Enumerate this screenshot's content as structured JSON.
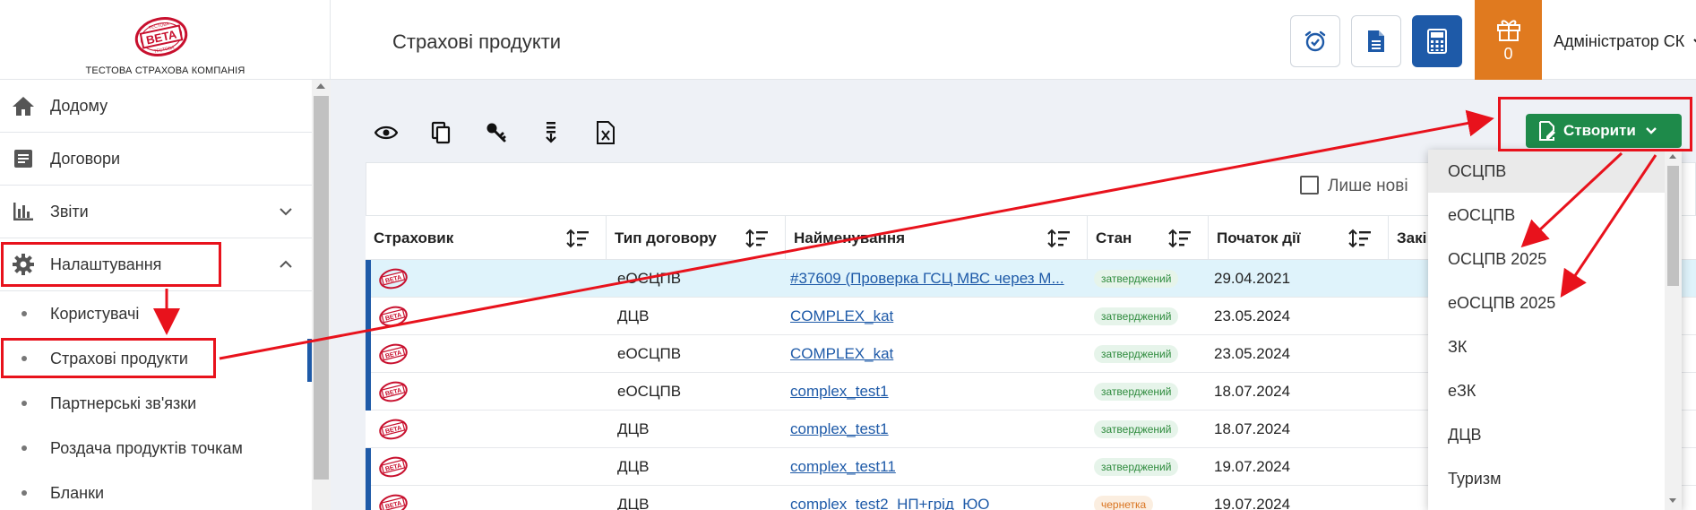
{
  "header": {
    "logo": {
      "seal_text": "BETA",
      "seal_top": "ТЕСТОВА",
      "seal_bottom": "ТЕСТОВА",
      "caption": "ТЕСТОВА СТРАХОВА КОМПАНІЯ"
    },
    "page_title": "Страхові продукти",
    "buttons": [
      {
        "name": "alarm-button",
        "icon": "alarm-clock-icon"
      },
      {
        "name": "document-button",
        "icon": "document-icon"
      },
      {
        "name": "calculator-button",
        "icon": "calculator-icon"
      }
    ],
    "gift": {
      "icon": "gift-icon",
      "count": "0"
    },
    "user": "Адміністратор СК"
  },
  "sidebar": {
    "items": [
      {
        "label": "Додому",
        "icon": "home-icon"
      },
      {
        "label": "Договори",
        "icon": "contract-icon"
      },
      {
        "label": "Звіти",
        "icon": "chart-icon",
        "expand": "chevron-down"
      },
      {
        "label": "Налаштування",
        "icon": "gear-icon",
        "expand": "chevron-up"
      }
    ],
    "subitems": [
      {
        "label": "Користувачі"
      },
      {
        "label": "Страхові продукти",
        "active": true
      },
      {
        "label": "Партнерські зв'язки"
      },
      {
        "label": "Роздача продуктів точкам"
      },
      {
        "label": "Бланки"
      }
    ]
  },
  "toolbar": {
    "icons": [
      "eye-icon",
      "copy-icon",
      "key-icon",
      "sort-download-icon",
      "excel-icon"
    ]
  },
  "filter": {
    "label": "Лише нові",
    "checked": false
  },
  "table": {
    "columns": [
      "Страховик",
      "Тип договору",
      "Найменування",
      "Стан",
      "Початок дії",
      "Закі"
    ],
    "rows": [
      {
        "type": "еОСЦПВ",
        "name": "#37609 (Проверка ГСЦ МВС через М...",
        "status": "затверджений",
        "start": "29.04.2021",
        "highlight": true,
        "bar": true
      },
      {
        "type": "ДЦВ",
        "name": "COMPLEX_kat",
        "status": "затверджений",
        "start": "23.05.2024",
        "bar": true
      },
      {
        "type": "еОСЦПВ",
        "name": "COMPLEX_kat",
        "status": "затверджений",
        "start": "23.05.2024",
        "bar": true
      },
      {
        "type": "еОСЦПВ",
        "name": "complex_test1",
        "status": "затверджений",
        "start": "18.07.2024",
        "bar": true
      },
      {
        "type": "ДЦВ",
        "name": "complex_test1",
        "status": "затверджений",
        "start": "18.07.2024",
        "bar": false
      },
      {
        "type": "ДЦВ",
        "name": "complex_test11",
        "status": "затверджений",
        "start": "19.07.2024",
        "bar": true
      },
      {
        "type": "ДЦВ",
        "name": "complex_test2_НП+грід_ЮО",
        "status": "чернетка",
        "start": "19.07.2024",
        "bar": true,
        "draft": true
      }
    ]
  },
  "create": {
    "label": "Створити",
    "icon": "file-edit-icon",
    "options": [
      "ОСЦПВ",
      "еОСЦПВ",
      "ОСЦПВ 2025",
      "еОСЦПВ 2025",
      "ЗК",
      "еЗК",
      "ДЦВ",
      "Туризм"
    ]
  },
  "colors": {
    "accent": "#1e5aa8",
    "create_green": "#1e8a4a",
    "gift_orange": "#e07a1f",
    "annotation_red": "#e8121c",
    "status_green": "#2e8b3d",
    "status_orange": "#d9731f"
  }
}
